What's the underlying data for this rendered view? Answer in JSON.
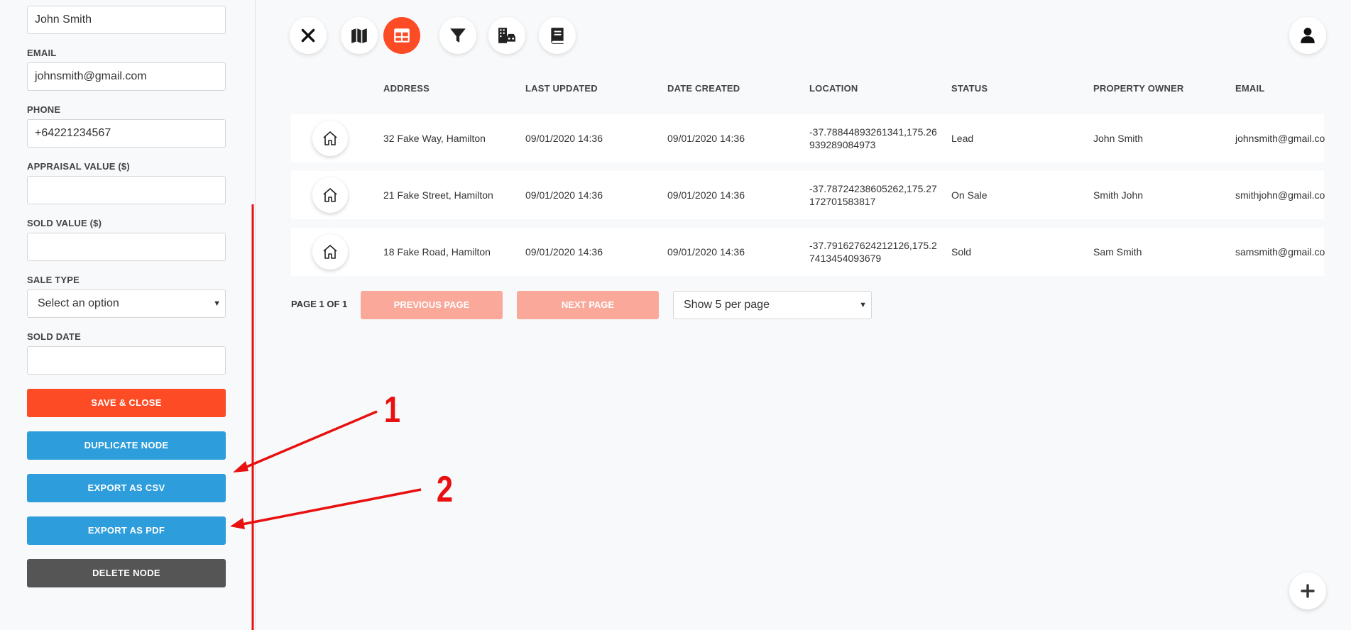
{
  "sidebar": {
    "name_value": "John Smith",
    "email_label": "EMAIL",
    "email_value": "johnsmith@gmail.com",
    "phone_label": "PHONE",
    "phone_value": "+64221234567",
    "appraisal_label": "APPRAISAL VALUE ($)",
    "appraisal_value": "",
    "sold_value_label": "SOLD VALUE ($)",
    "sold_value_value": "",
    "sale_type_label": "SALE TYPE",
    "sale_type_value": "Select an option",
    "sold_date_label": "SOLD DATE",
    "sold_date_value": "",
    "save_close_label": "SAVE & CLOSE",
    "duplicate_label": "DUPLICATE NODE",
    "export_csv_label": "EXPORT AS CSV",
    "export_pdf_label": "EXPORT AS PDF",
    "delete_label": "DELETE NODE"
  },
  "toolbar": {
    "items": [
      "close-icon",
      "map-icon",
      "table-icon",
      "filter-icon",
      "building-car-icon",
      "book-icon"
    ],
    "active": "table-icon",
    "user_icon": "user-icon"
  },
  "table": {
    "headers": [
      "ADDRESS",
      "LAST UPDATED",
      "DATE CREATED",
      "LOCATION",
      "STATUS",
      "PROPERTY OWNER",
      "EMAIL"
    ],
    "rows": [
      {
        "address": "32 Fake Way, Hamilton",
        "last_updated": "09/01/2020 14:36",
        "date_created": "09/01/2020 14:36",
        "location": "-37.78844893261341,175.26939289084973",
        "status": "Lead",
        "owner": "John Smith",
        "email": "johnsmith@gmail.co"
      },
      {
        "address": "21 Fake Street, Hamilton",
        "last_updated": "09/01/2020 14:36",
        "date_created": "09/01/2020 14:36",
        "location": "-37.78724238605262,175.27172701583817",
        "status": "On Sale",
        "owner": "Smith John",
        "email": "smithjohn@gmail.co"
      },
      {
        "address": "18 Fake Road, Hamilton",
        "last_updated": "09/01/2020 14:36",
        "date_created": "09/01/2020 14:36",
        "location": "-37.791627624212126,175.27413454093679",
        "status": "Sold",
        "owner": "Sam Smith",
        "email": "samsmith@gmail.co"
      }
    ]
  },
  "pagination": {
    "page_label": "PAGE 1 OF 1",
    "previous_label": "PREVIOUS PAGE",
    "next_label": "NEXT PAGE",
    "per_page_value": "Show 5 per page"
  },
  "annotations": {
    "label_1": "1",
    "label_2": "2",
    "color": "#e81010"
  },
  "colors": {
    "accent": "#fd4b26",
    "blue": "#2e9ddb",
    "dark": "#555555",
    "disabled": "#f9a89a"
  }
}
